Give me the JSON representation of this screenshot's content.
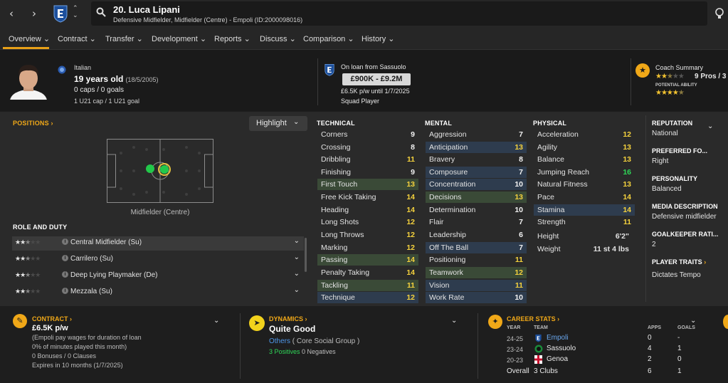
{
  "header": {
    "title": "20. Luca Lipani",
    "subtitle": "Defensive Midfielder, Midfielder (Centre) - Empoli (ID:2000098016)"
  },
  "tabs": [
    "Overview",
    "Contract",
    "Transfer",
    "Development",
    "Reports",
    "Discuss",
    "Comparison",
    "History"
  ],
  "profile": {
    "nationality": "Italian",
    "age": "19 years old",
    "dob": "(18/5/2005)",
    "caps": "0 caps / 0 goals",
    "u21": "1 U21 cap / 1 U21 goal"
  },
  "loan": {
    "label": "On loan from Sassuolo",
    "value": "£900K - £9.2M",
    "wage": "£6.5K p/w until 1/7/2025",
    "status": "Squad Player"
  },
  "coach": {
    "title": "Coach Summary",
    "pros": "9 Pros / 3",
    "potential_label": "POTENTIAL ABILITY",
    "current_stars": 2.5,
    "potential_stars": 4.5
  },
  "positions": {
    "title": "POSITIONS",
    "highlight": "Highlight",
    "caption": "Midfielder (Centre)"
  },
  "role_section": {
    "title": "ROLE AND DUTY",
    "roles": [
      {
        "stars": 2.5,
        "label": "Central Midfielder (Su)"
      },
      {
        "stars": 2.5,
        "label": "Carrilero (Su)"
      },
      {
        "stars": 2.5,
        "label": "Deep Lying Playmaker (De)"
      },
      {
        "stars": 2.5,
        "label": "Mezzala (Su)"
      }
    ]
  },
  "technical": {
    "title": "TECHNICAL",
    "attrs": [
      {
        "name": "Corners",
        "value": "9"
      },
      {
        "name": "Crossing",
        "value": "8"
      },
      {
        "name": "Dribbling",
        "value": "11"
      },
      {
        "name": "Finishing",
        "value": "9"
      },
      {
        "name": "First Touch",
        "value": "13"
      },
      {
        "name": "Free Kick Taking",
        "value": "14"
      },
      {
        "name": "Heading",
        "value": "14"
      },
      {
        "name": "Long Shots",
        "value": "12"
      },
      {
        "name": "Long Throws",
        "value": "12"
      },
      {
        "name": "Marking",
        "value": "12"
      },
      {
        "name": "Passing",
        "value": "14"
      },
      {
        "name": "Penalty Taking",
        "value": "14"
      },
      {
        "name": "Tackling",
        "value": "11"
      },
      {
        "name": "Technique",
        "value": "12"
      }
    ]
  },
  "mental": {
    "title": "MENTAL",
    "attrs": [
      {
        "name": "Aggression",
        "value": "7"
      },
      {
        "name": "Anticipation",
        "value": "13"
      },
      {
        "name": "Bravery",
        "value": "8"
      },
      {
        "name": "Composure",
        "value": "7"
      },
      {
        "name": "Concentration",
        "value": "10"
      },
      {
        "name": "Decisions",
        "value": "13"
      },
      {
        "name": "Determination",
        "value": "10"
      },
      {
        "name": "Flair",
        "value": "7"
      },
      {
        "name": "Leadership",
        "value": "6"
      },
      {
        "name": "Off The Ball",
        "value": "7"
      },
      {
        "name": "Positioning",
        "value": "11"
      },
      {
        "name": "Teamwork",
        "value": "12"
      },
      {
        "name": "Vision",
        "value": "11"
      },
      {
        "name": "Work Rate",
        "value": "10"
      }
    ]
  },
  "physical": {
    "title": "PHYSICAL",
    "attrs": [
      {
        "name": "Acceleration",
        "value": "12"
      },
      {
        "name": "Agility",
        "value": "13"
      },
      {
        "name": "Balance",
        "value": "13"
      },
      {
        "name": "Jumping Reach",
        "value": "16"
      },
      {
        "name": "Natural Fitness",
        "value": "13"
      },
      {
        "name": "Pace",
        "value": "14"
      },
      {
        "name": "Stamina",
        "value": "14"
      },
      {
        "name": "Strength",
        "value": "11"
      }
    ],
    "height_label": "Height",
    "height": "6'2\"",
    "weight_label": "Weight",
    "weight": "11 st 4 lbs"
  },
  "right_panel": {
    "reputation_title": "REPUTATION",
    "reputation": "National",
    "preferred_foot_title": "PREFERRED FO...",
    "preferred_foot": "Right",
    "personality_title": "PERSONALITY",
    "personality": "Balanced",
    "media_title": "MEDIA DESCRIPTION",
    "media": "Defensive midfielder",
    "gk_title": "GOALKEEPER RATI...",
    "gk": "2",
    "traits_title": "PLAYER TRAITS",
    "traits": "Dictates Tempo"
  },
  "contract": {
    "title": "CONTRACT",
    "wage": "£6.5K p/w",
    "line1": "(Empoli pay wages for duration of loan",
    "line2": "0% of minutes played this month)",
    "line3": "0 Bonuses / 0 Clauses",
    "line4": "Expires in 10 months (1/7/2025)"
  },
  "dynamics": {
    "title": "DYNAMICS",
    "value": "Quite Good",
    "group_prefix": "Others",
    "group_suffix": "( Core Social Group )",
    "positives": "3 Positives",
    "negatives": "0 Negatives"
  },
  "career": {
    "title": "CAREER STATS",
    "col_year": "YEAR",
    "col_team": "TEAM",
    "col_apps": "APPS",
    "col_goals": "GOALS",
    "rows": [
      {
        "year": "24-25",
        "team": "Empoli",
        "apps": "0",
        "goals": "-"
      },
      {
        "year": "23-24",
        "team": "Sassuolo",
        "apps": "4",
        "goals": "1"
      },
      {
        "year": "20-23",
        "team": "Genoa",
        "apps": "2",
        "goals": "0"
      }
    ],
    "overall_label": "Overall",
    "overall_team": "3 Clubs",
    "overall_apps": "6",
    "overall_goals": "1"
  },
  "colors": {
    "accent": "#f0a818",
    "highlight": "#2e3c4e",
    "green_highlight": "#3a4a37",
    "yellow_value": "#f5d23d",
    "green_value": "#2fd858"
  }
}
